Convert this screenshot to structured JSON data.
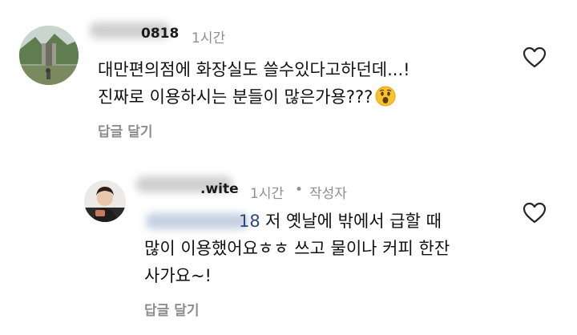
{
  "comments": [
    {
      "handle_visible": "0818",
      "time": "1시간",
      "lines": [
        "대만편의점에 화장실도 쓸수있다고하던데...!",
        "진짜로 이용하시는 분들이 많은가용???"
      ],
      "emoji_icon": "astonished-face-emoji",
      "reply_label": "답글 달기",
      "like_icon": "heart-outline-icon"
    }
  ],
  "replies": [
    {
      "handle_visible": ".wite",
      "time": "1시간",
      "separator": "•",
      "author_badge": "작성자",
      "mention_visible": "18",
      "lines": [
        "저 옛날에 밖에서 급할 때",
        "많이 이용했어요ㅎㅎ 쓰고 물이나 커피 한잔",
        "사가요~!"
      ],
      "reply_label": "답글 달기",
      "like_icon": "heart-outline-icon"
    }
  ],
  "colors": {
    "text": "#111111",
    "secondary": "#8e8e8e",
    "mention": "#2b4a7a"
  }
}
